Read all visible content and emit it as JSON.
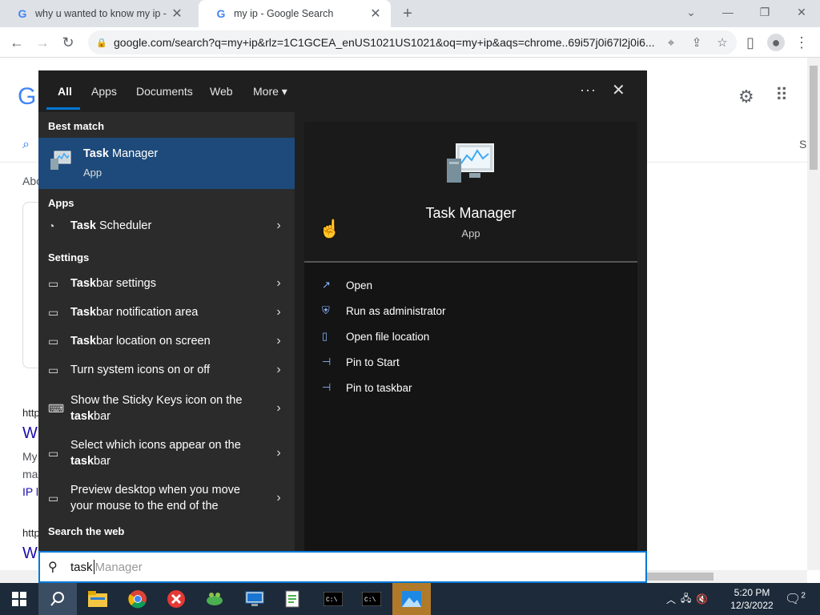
{
  "browser": {
    "tabs": [
      {
        "label": "why u wanted to know my ip - G",
        "favicon": "google-g-icon"
      },
      {
        "label": "my ip - Google Search",
        "favicon": "google-g-icon"
      }
    ],
    "new_tab": "+",
    "url": "google.com/search?q=my+ip&rlz=1C1GCEA_enUS1021US1021&oq=my+ip&aqs=chrome..69i57j0i67l2j0i6...",
    "window_controls": [
      "minimize",
      "restore",
      "close"
    ]
  },
  "google_page": {
    "logo_fragment": "G",
    "about_fragment": "Abo",
    "results": [
      {
        "cite": "http",
        "title": "W",
        "snippet": [
          "My",
          "ma"
        ],
        "link": "IP l"
      },
      {
        "cite": "http",
        "title": "W"
      }
    ],
    "tab_fragment": "S"
  },
  "start_menu": {
    "filters": [
      {
        "label": "All",
        "selected": true
      },
      {
        "label": "Apps"
      },
      {
        "label": "Documents"
      },
      {
        "label": "Web"
      },
      {
        "label": "More ▾"
      }
    ],
    "more_options": "···",
    "close": "✕",
    "best_match_heading": "Best match",
    "best_match": {
      "bold": "Task",
      "rest": " Manager",
      "type": "App"
    },
    "apps_heading": "Apps",
    "apps": [
      {
        "bold": "Task",
        "rest": " Scheduler",
        "icon": "clock-icon"
      }
    ],
    "settings_heading": "Settings",
    "settings": [
      {
        "bold": "Task",
        "rest": "bar settings",
        "icon": "monitor-icon"
      },
      {
        "bold": "Task",
        "rest": "bar notification area",
        "icon": "monitor-icon"
      },
      {
        "bold": "Task",
        "rest": "bar location on screen",
        "icon": "monitor-icon"
      },
      {
        "pre": "Turn system icons on or off",
        "icon": "monitor-icon"
      },
      {
        "pre": "Show the Sticky Keys icon on the",
        "bold": "task",
        "rest": "bar",
        "icon": "keyboard-icon"
      },
      {
        "pre": "Select which icons appear on the",
        "bold": "task",
        "rest": "bar",
        "icon": "monitor-icon"
      },
      {
        "pre": "Preview desktop when you move",
        "pre2": "your mouse to the end of the",
        "icon": "monitor-icon"
      }
    ],
    "web_heading": "Search the web",
    "preview": {
      "title": "Task Manager",
      "subtitle": "App",
      "actions": [
        {
          "label": "Open",
          "icon": "open-icon"
        },
        {
          "label": "Run as administrator",
          "icon": "shield-icon"
        },
        {
          "label": "Open file location",
          "icon": "folder-icon"
        },
        {
          "label": "Pin to Start",
          "icon": "pin-icon"
        },
        {
          "label": "Pin to taskbar",
          "icon": "pin-icon"
        }
      ]
    },
    "search": {
      "typed": "task",
      "suggestion": " Manager"
    }
  },
  "taskbar": {
    "apps": [
      "start-icon",
      "search-icon",
      "file-explorer-icon",
      "chrome-icon",
      "x-app-icon",
      "frog-app-icon",
      "network-app-icon",
      "notepad-app-icon",
      "terminal-icon",
      "terminal-icon",
      "photos-icon"
    ],
    "time": "5:20 PM",
    "date": "12/3/2022",
    "notification_count": "2"
  }
}
